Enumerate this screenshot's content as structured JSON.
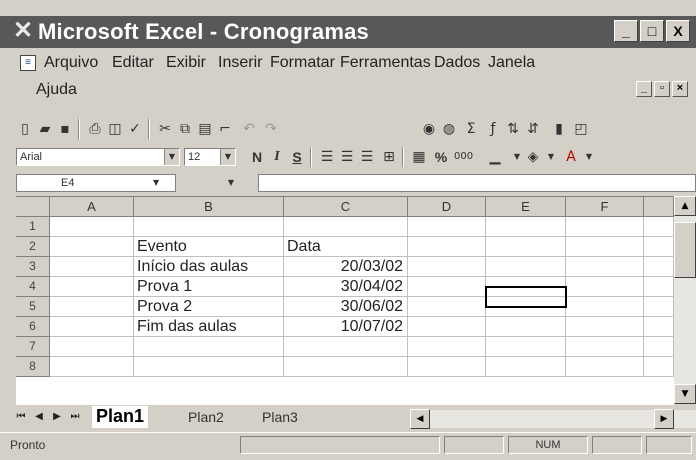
{
  "window": {
    "title": "Microsoft Excel - Cronogramas",
    "minimize_glyph": "_",
    "maximize_glyph": "□",
    "close_glyph": "X"
  },
  "menu": [
    {
      "label": "Arquivo"
    },
    {
      "label": "Editar"
    },
    {
      "label": "Exibir"
    },
    {
      "label": "Inserir"
    },
    {
      "label": "Formatar"
    },
    {
      "label": "Ferramentas"
    },
    {
      "label": "Dados"
    },
    {
      "label": "Janela"
    },
    {
      "label": "Ajuda"
    }
  ],
  "formatting": {
    "font_name": "Arial",
    "font_size": "12",
    "bold_glyph": "N",
    "italic_glyph": "I",
    "underline_glyph": "S",
    "percent_glyph": "%"
  },
  "formula_bar": {
    "name_box": "E4",
    "formula": ""
  },
  "grid": {
    "columns": [
      "A",
      "B",
      "C",
      "D",
      "E",
      "F"
    ],
    "rows": [
      "1",
      "2",
      "3",
      "4",
      "5",
      "6",
      "7",
      "8"
    ],
    "cells": {
      "B2": "Evento",
      "C2": "Data",
      "B3": "Início das aulas",
      "C3": "20/03/02",
      "B4": "Prova 1",
      "C4": "30/04/02",
      "B5": "Prova 2",
      "C5": "30/06/02",
      "B6": "Fim das aulas",
      "C6": "10/07/02"
    },
    "active_cell": "E4"
  },
  "sheets": {
    "tabs": [
      "Plan1",
      "Plan2",
      "Plan3"
    ],
    "active": "Plan1"
  },
  "status": {
    "mode": "Pronto",
    "num_indicator": "NUM"
  }
}
